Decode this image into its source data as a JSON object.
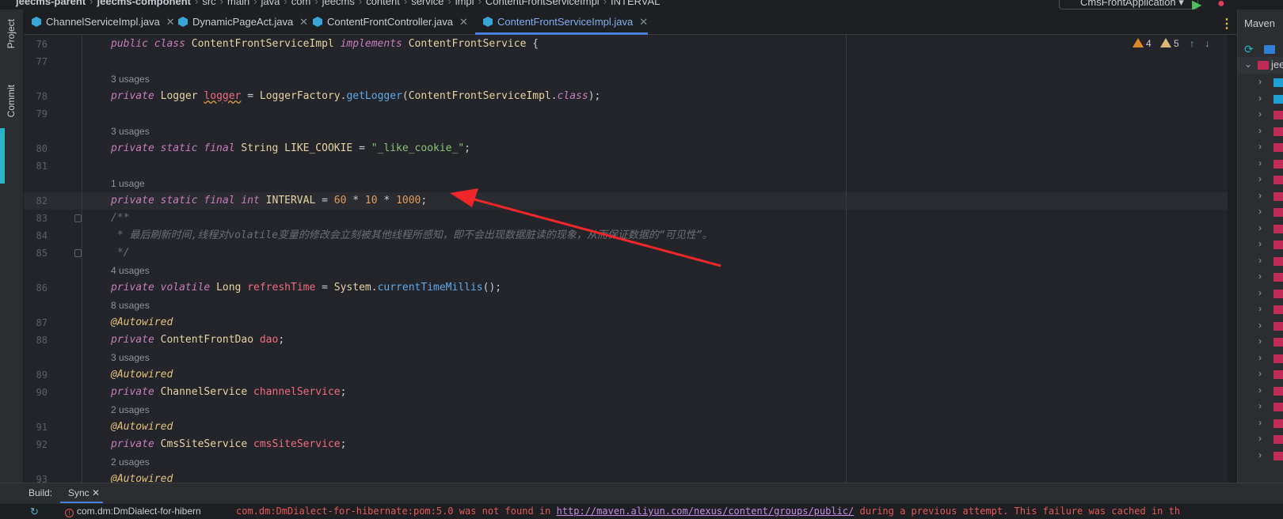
{
  "breadcrumb": [
    "jeecms-parent",
    "jeecms-component",
    "src",
    "main",
    "java",
    "com",
    "jeecms",
    "content",
    "service",
    "impl",
    "ContentFrontServiceImpl",
    "INTERVAL"
  ],
  "run_config": "CmsFrontApplication",
  "left_tools": {
    "project": "Project",
    "commit": "Commit"
  },
  "tabs": [
    {
      "label": "ChannelServiceImpl.java",
      "active": false
    },
    {
      "label": "DynamicPageAct.java",
      "active": false
    },
    {
      "label": "ContentFrontController.java",
      "active": false
    },
    {
      "label": "ContentFrontServiceImpl.java",
      "active": true
    }
  ],
  "inspections": {
    "warnings": "4",
    "weak_warnings": "5"
  },
  "maven": {
    "title": "Maven",
    "root": "jee"
  },
  "colors": {
    "keyword": "#c77dbb",
    "field": "#ef6b80",
    "method": "#5fa8e6",
    "number": "#e09a5a",
    "string": "#89c275",
    "annotation": "#e3c27a",
    "arrow": "#f0262a"
  },
  "editor": {
    "lines": [
      {
        "num": "76",
        "tokens": [
          [
            "kw",
            "public class "
          ],
          [
            "ty",
            "ContentFrontServiceImpl "
          ],
          [
            "kw",
            "implements "
          ],
          [
            "ty",
            "ContentFrontService "
          ],
          [
            "pl",
            "{"
          ]
        ]
      },
      {
        "num": "77",
        "tokens": []
      },
      {
        "usage": "3 usages"
      },
      {
        "num": "78",
        "tokens": [
          [
            "kw",
            "private "
          ],
          [
            "ty",
            "Logger "
          ],
          [
            "fd wavy",
            "logger"
          ],
          [
            "pl",
            " = "
          ],
          [
            "ty",
            "LoggerFactory"
          ],
          [
            "pl",
            "."
          ],
          [
            "mt",
            "getLogger"
          ],
          [
            "pl",
            "("
          ],
          [
            "ty",
            "ContentFrontServiceImpl"
          ],
          [
            "pl",
            "."
          ],
          [
            "kw",
            "class"
          ],
          [
            "pl",
            ");"
          ]
        ]
      },
      {
        "num": "79",
        "tokens": []
      },
      {
        "usage": "3 usages"
      },
      {
        "num": "80",
        "tokens": [
          [
            "kw",
            "private static final "
          ],
          [
            "ty",
            "String LIKE_COOKIE"
          ],
          [
            "pl",
            " = "
          ],
          [
            "str",
            "\"_like_cookie_\""
          ],
          [
            "pl",
            ";"
          ]
        ]
      },
      {
        "num": "81",
        "tokens": []
      },
      {
        "usage": "1 usage"
      },
      {
        "num": "82",
        "current": true,
        "tokens": [
          [
            "kw",
            "private static final int "
          ],
          [
            "ty",
            "INTERVAL"
          ],
          [
            "pl",
            " = "
          ],
          [
            "num",
            "60"
          ],
          [
            "pl",
            " * "
          ],
          [
            "num",
            "10"
          ],
          [
            "pl",
            " * "
          ],
          [
            "num",
            "1000"
          ],
          [
            "pl",
            ";"
          ]
        ]
      },
      {
        "num": "83",
        "fold": true,
        "tokens": [
          [
            "cm",
            "/**"
          ]
        ]
      },
      {
        "num": "84",
        "tokens": [
          [
            "cm",
            " * 最后刷新时间,线程对volatile变量的修改会立刻被其他线程所感知，即不会出现数据脏读的现象，从而保证数据的“可见性”。"
          ]
        ]
      },
      {
        "num": "85",
        "fold": true,
        "tokens": [
          [
            "cm",
            " */"
          ]
        ]
      },
      {
        "usage": "4 usages"
      },
      {
        "num": "86",
        "tokens": [
          [
            "kw",
            "private volatile "
          ],
          [
            "ty",
            "Long "
          ],
          [
            "fd",
            "refreshTime"
          ],
          [
            "pl",
            " = "
          ],
          [
            "ty",
            "System"
          ],
          [
            "pl",
            "."
          ],
          [
            "mt",
            "currentTimeMillis"
          ],
          [
            "pl",
            "();"
          ]
        ]
      },
      {
        "usage": "8 usages"
      },
      {
        "num": "87",
        "tokens": [
          [
            "an",
            "@Autowired"
          ]
        ]
      },
      {
        "num": "88",
        "tokens": [
          [
            "kw",
            "private "
          ],
          [
            "ty",
            "ContentFrontDao "
          ],
          [
            "fd",
            "dao"
          ],
          [
            "pl",
            ";"
          ]
        ]
      },
      {
        "usage": "3 usages"
      },
      {
        "num": "89",
        "tokens": [
          [
            "an",
            "@Autowired"
          ]
        ]
      },
      {
        "num": "90",
        "tokens": [
          [
            "kw",
            "private "
          ],
          [
            "ty",
            "ChannelService "
          ],
          [
            "fd",
            "channelService"
          ],
          [
            "pl",
            ";"
          ]
        ]
      },
      {
        "usage": "2 usages"
      },
      {
        "num": "91",
        "tokens": [
          [
            "an",
            "@Autowired"
          ]
        ]
      },
      {
        "num": "92",
        "tokens": [
          [
            "kw",
            "private "
          ],
          [
            "ty",
            "CmsSiteService "
          ],
          [
            "fd",
            "cmsSiteService"
          ],
          [
            "pl",
            ";"
          ]
        ]
      },
      {
        "usage": "2 usages"
      },
      {
        "num": "93",
        "tokens": [
          [
            "an",
            "@Autowired"
          ]
        ]
      }
    ]
  },
  "build": {
    "label": "Build:",
    "tab": "Sync",
    "error_node": "com.dm:DmDialect-for-hibern",
    "error_prefix": "com.dm:DmDialect-for-hibernate:pom:5.0 was not found in ",
    "error_link": "http://maven.aliyun.com/nexus/content/groups/public/",
    "error_suffix": " during a previous attempt. This failure was cached in th"
  }
}
